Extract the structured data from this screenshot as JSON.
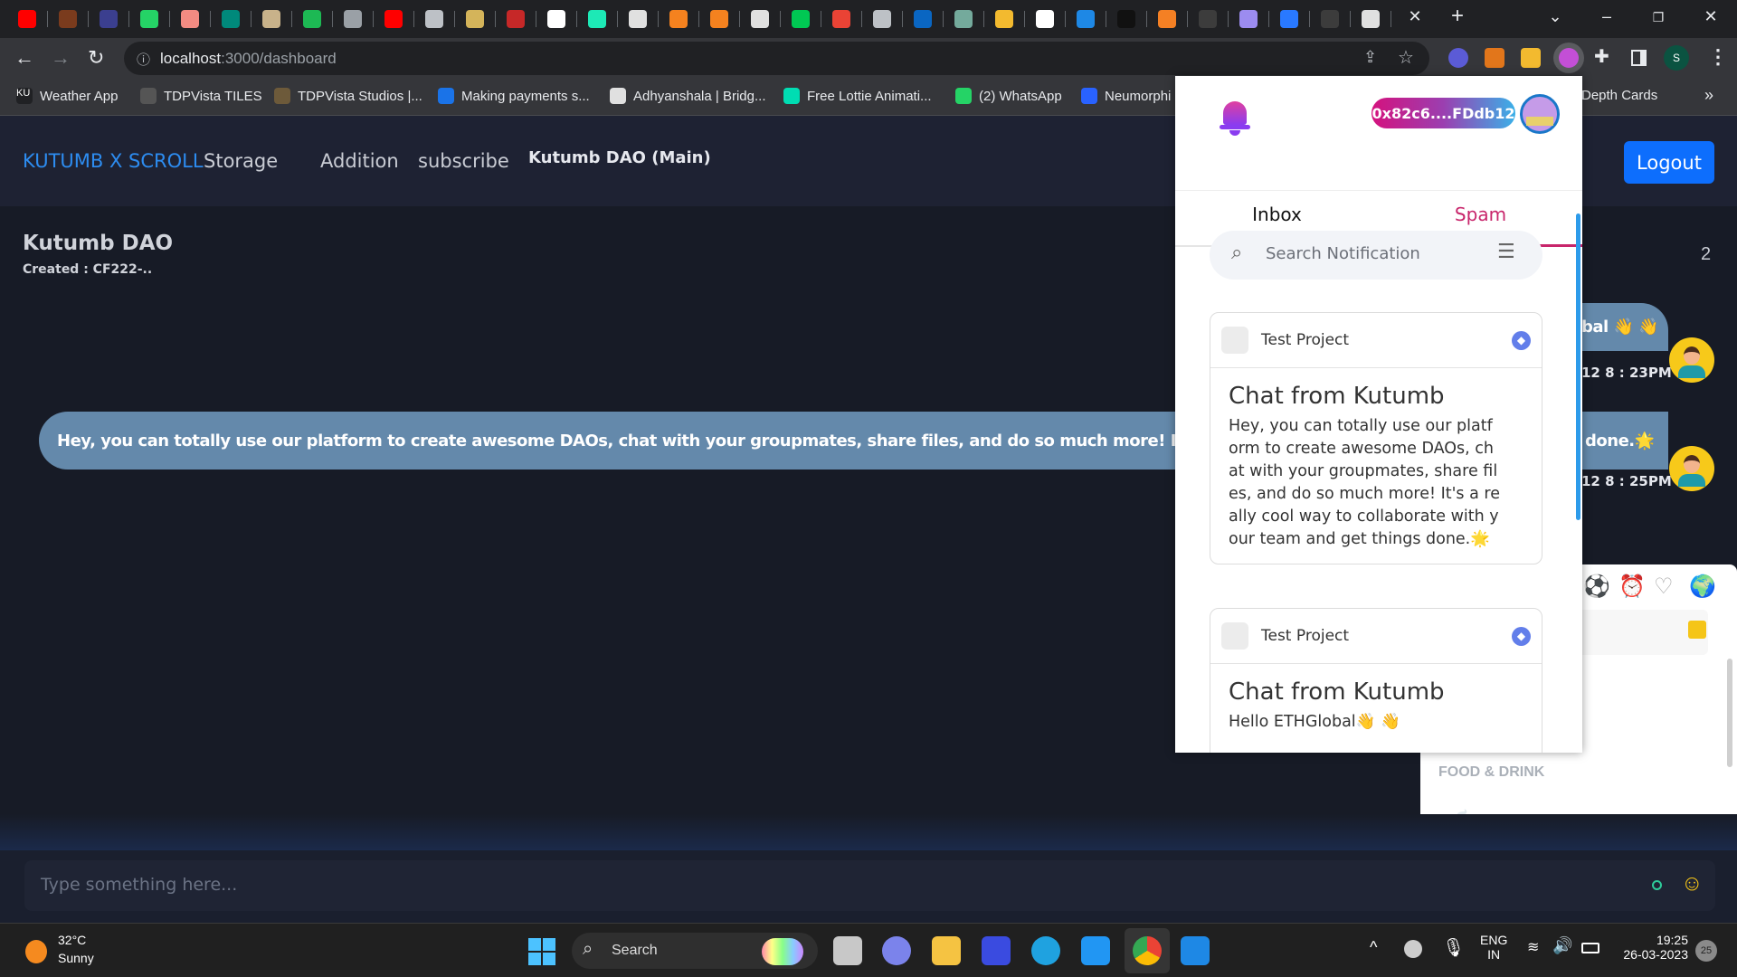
{
  "browser": {
    "tab_icons": [
      {
        "name": "youtube-icon",
        "color": "#ff0000"
      },
      {
        "name": "v-icon",
        "color": "#7a3b1d"
      },
      {
        "name": "code-icon",
        "color": "#3b3f8f"
      },
      {
        "name": "whatsapp-icon",
        "color": "#25d366"
      },
      {
        "name": "record-icon",
        "color": "#f28b82"
      },
      {
        "name": "meet-icon",
        "color": "#00897b"
      },
      {
        "name": "scroll-icon",
        "color": "#c8b28a"
      },
      {
        "name": "alchemy-icon",
        "color": "#1db954"
      },
      {
        "name": "alchemy-grey-icon",
        "color": "#9aa0a6"
      },
      {
        "name": "youtube-icon",
        "color": "#ff0000"
      },
      {
        "name": "globe-icon",
        "color": "#bdc1c6"
      },
      {
        "name": "m-icon",
        "color": "#d4b45a"
      },
      {
        "name": "badge-icon",
        "color": "#c62828"
      },
      {
        "name": "github-icon",
        "color": "#ffffff"
      },
      {
        "name": "doc-icon",
        "color": "#1de9b6"
      },
      {
        "name": "r-icon",
        "color": "#e0e0e0"
      },
      {
        "name": "g-icon",
        "color": "#f5821f"
      },
      {
        "name": "g-icon",
        "color": "#f5821f"
      },
      {
        "name": "news-icon",
        "color": "#e0e0e0"
      },
      {
        "name": "f-icon",
        "color": "#00c853"
      },
      {
        "name": "gmail-icon",
        "color": "#ea4335"
      },
      {
        "name": "download-icon",
        "color": "#bdc1c6"
      },
      {
        "name": "linkedin-icon",
        "color": "#0a66c2"
      },
      {
        "name": "chatgpt-icon",
        "color": "#74aa9c"
      },
      {
        "name": "binance-icon",
        "color": "#f3ba2f"
      },
      {
        "name": "github-icon",
        "color": "#ffffff"
      },
      {
        "name": "a-icon",
        "color": "#1e88e5"
      },
      {
        "name": "d-icon",
        "color": "#111111"
      },
      {
        "name": "stack-icon",
        "color": "#f48024"
      },
      {
        "name": "android-icon",
        "color": "#3c3c3c"
      },
      {
        "name": "eyes-icon",
        "color": "#9c8cf0"
      },
      {
        "name": "d-blue-icon",
        "color": "#2979ff"
      },
      {
        "name": "android-icon",
        "color": "#3c3c3c"
      },
      {
        "name": "chrome-icon",
        "color": "#e0e0e0"
      }
    ],
    "active_tab_close": "✕",
    "new_tab": "+",
    "url_host": "localhost",
    "url_path": ":3000/dashboard",
    "bookmarks": [
      {
        "label": "Weather App",
        "icon": "ku-icon",
        "color": "#202124",
        "text": "KU"
      },
      {
        "label": "TDPVista TILES",
        "icon": "tdp-icon",
        "color": "#555555",
        "text": ""
      },
      {
        "label": "TDPVista Studios |...",
        "icon": "studio-icon",
        "color": "#6d5a3a",
        "text": ""
      },
      {
        "label": "Making payments s...",
        "icon": "circle-icon",
        "color": "#1a73e8",
        "text": ""
      },
      {
        "label": "Adhyanshala | Bridg...",
        "icon": "building-icon",
        "color": "#e0e0e0",
        "text": ""
      },
      {
        "label": "Free Lottie Animati...",
        "icon": "lottie-icon",
        "color": "#00ddb3",
        "text": ""
      },
      {
        "label": "(2) WhatsApp",
        "icon": "whatsapp-icon",
        "color": "#25d366",
        "text": ""
      },
      {
        "label": "Neumorphi",
        "icon": "neumorph-icon",
        "color": "#2962ff",
        "text": ""
      }
    ],
    "bookmark_overflow_label": "Depth Cards",
    "bookmark_more": "»",
    "profile_initial": "S"
  },
  "app": {
    "nav": {
      "brand": "KUTUMB X SCROLL",
      "storage": "Storage",
      "addition": "Addition",
      "subscribe": "subscribe",
      "dao_main": "Kutumb DAO (Main)"
    },
    "logout": "Logout",
    "dao_title": "Kutumb DAO",
    "dao_created": "Created : CF222-..",
    "member_count": "2",
    "messages": [
      {
        "text_visible": "bal 👋 👋",
        "time": "12 8 : 23PM"
      },
      {
        "text": "Hey, you can totally use our platform to create awesome DAOs, chat with your groupmates, share files, and do so much more! It's a really coo",
        "tail": "done.🌟",
        "time": "12 8 : 25PM"
      }
    ],
    "input_placeholder": "Type something here...",
    "emoji_picker": {
      "category_label": "FOOD & DRINK",
      "first_emoji": "☕"
    }
  },
  "notifications": {
    "address": "0x82c6....FDdb12",
    "tabs": {
      "inbox": "Inbox",
      "spam": "Spam",
      "active": "spam"
    },
    "search_placeholder": "Search Notification",
    "accent": "#c8256b",
    "items": [
      {
        "project": "Test Project",
        "title": "Chat from Kutumb",
        "body": "Hey, you can totally use our platform to create awesome DAOs, chat with your groupmates, share files, and do so much more! It's a really cool way to collaborate with your team and get things done.🌟"
      },
      {
        "project": "Test Project",
        "title": "Chat from Kutumb",
        "body": "Hello ETHGlobal👋 👋"
      }
    ]
  },
  "taskbar": {
    "weather_temp": "32°C",
    "weather_desc": "Sunny",
    "search": "Search",
    "lang": "ENG",
    "region": "IN",
    "time": "19:25",
    "date": "26-03-2023",
    "notif_count": "25"
  }
}
